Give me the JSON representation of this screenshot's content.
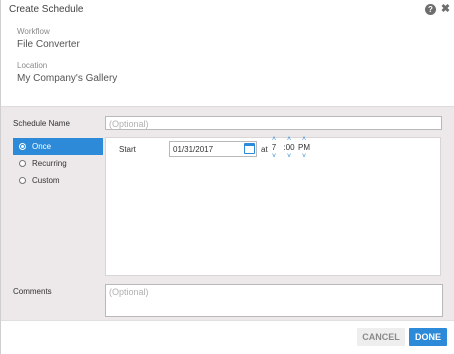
{
  "dialog": {
    "title": "Create Schedule",
    "help_icon": "?",
    "close_icon": "✖"
  },
  "info": {
    "workflow_label": "Workflow",
    "workflow_value": "File Converter",
    "location_label": "Location",
    "location_value": "My Company's Gallery"
  },
  "form": {
    "schedule_name_label": "Schedule Name",
    "schedule_name_placeholder": "(Optional)",
    "frequency_options": [
      {
        "label": "Once",
        "selected": true
      },
      {
        "label": "Recurring",
        "selected": false
      },
      {
        "label": "Custom",
        "selected": false
      }
    ],
    "start_label": "Start",
    "start_date": "01/31/2017",
    "at_label": "at",
    "hour": "7",
    "minute": ":00",
    "meridiem": "PM",
    "comments_label": "Comments",
    "comments_placeholder": "(Optional)"
  },
  "footer": {
    "cancel_label": "CANCEL",
    "done_label": "DONE"
  },
  "colors": {
    "accent": "#2c8ad8",
    "panel_bg": "#ede8ea"
  }
}
